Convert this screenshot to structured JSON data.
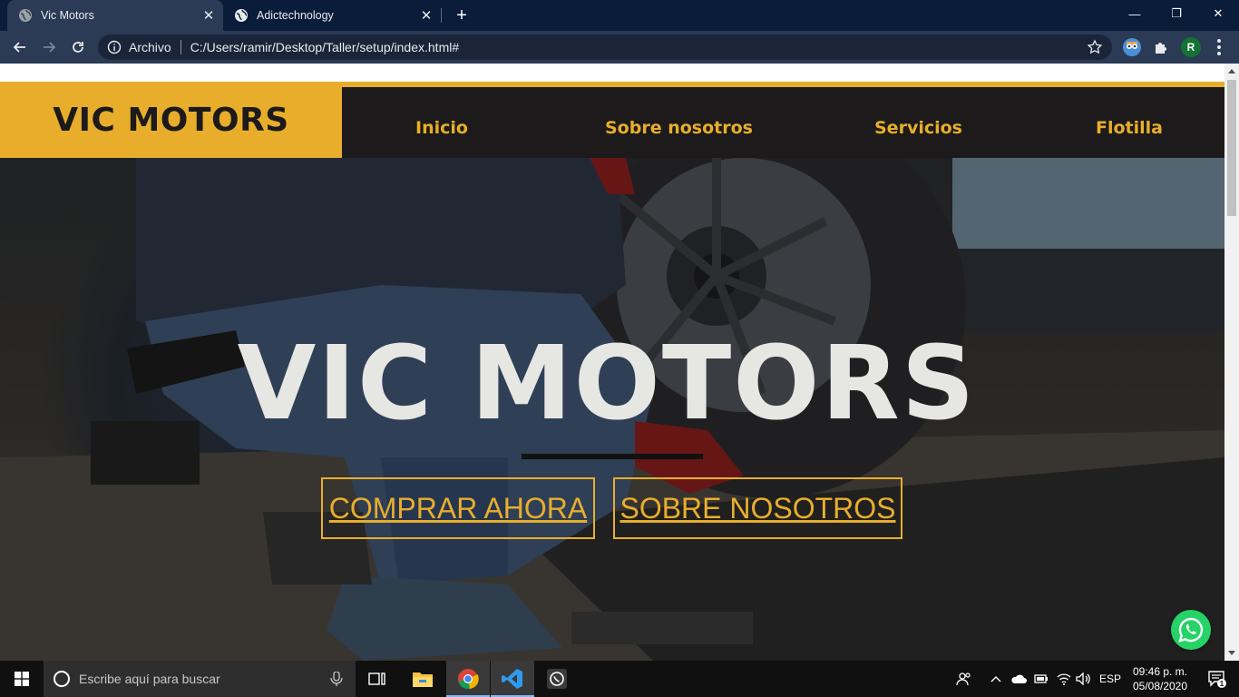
{
  "browser": {
    "tabs": [
      {
        "title": "Vic Motors",
        "icon": "globe-icon",
        "active": true
      },
      {
        "title": "Adictechnology",
        "icon": "globe-icon",
        "active": false
      }
    ],
    "omnibox": {
      "scheme_label": "Archivo",
      "url": "C:/Users/ramir/Desktop/Taller/setup/index.html#"
    },
    "profile_initial": "R",
    "controls": {
      "minimize": "—",
      "maximize": "❐",
      "close": "✕",
      "tab_close": "✕",
      "new_tab": "+"
    }
  },
  "site": {
    "brand": "VIC MOTORS",
    "nav": [
      "Inicio",
      "Sobre nosotros",
      "Servicios",
      "Flotilla"
    ],
    "hero": {
      "title": "VIC MOTORS",
      "buttons": [
        "COMPRAR AHORA",
        "SOBRE NOSOTROS"
      ]
    },
    "colors": {
      "accent": "#e8ae2b",
      "header_bg": "#1c1a1a",
      "hero_text": "#e6e6e3",
      "whatsapp": "#25d366"
    }
  },
  "taskbar": {
    "search_placeholder": "Escribe aquí para buscar",
    "language": "ESP",
    "time": "09:46 p. m.",
    "date": "05/08/2020",
    "notification_count": "1",
    "pinned": [
      "task-view-icon",
      "file-explorer-icon",
      "chrome-icon",
      "vscode-icon",
      "whatsapp-icon"
    ]
  }
}
